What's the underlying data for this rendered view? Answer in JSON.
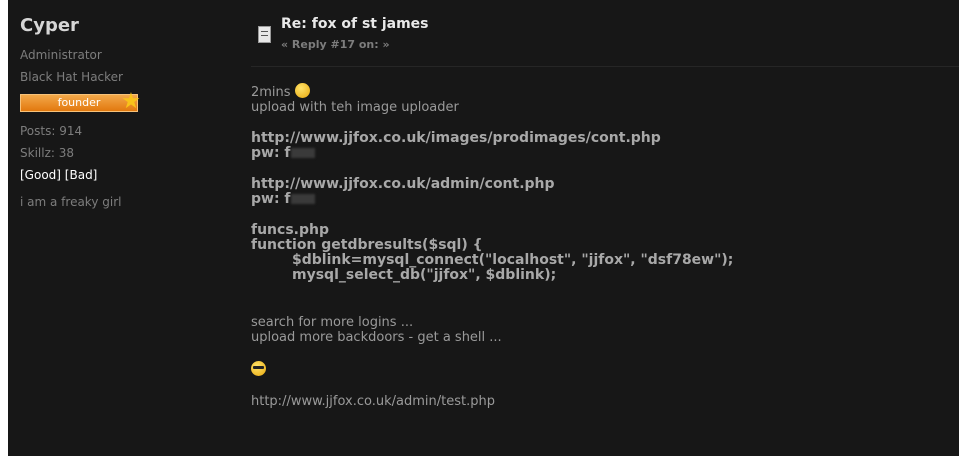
{
  "sidebar": {
    "username": "Cyper",
    "role": "Administrator",
    "title": "Black Hat Hacker",
    "badge_label": "founder",
    "posts": "Posts: 914",
    "skillz": "Skillz: 38",
    "karma_good": "[Good]",
    "karma_bad": "[Bad]",
    "personal_text": "i am a freaky girl"
  },
  "post": {
    "title": "Re: fox of st james",
    "reply_label": "« Reply #17 on: »",
    "lines": {
      "l1": "2mins",
      "l2": "upload with teh image uploader",
      "url1": "http://www.jjfox.co.uk/images/prodimages/cont.php",
      "pw1": "pw: f",
      "url2": "http://www.jjfox.co.uk/admin/cont.php",
      "pw2": "pw: f",
      "code1": "funcs.php",
      "code2": "function getdbresults($sql) {",
      "code3": "$dblink=mysql_connect(\"localhost\", \"jjfox\", \"dsf78ew\");",
      "code4": "mysql_select_db(\"jjfox\", $dblink);",
      "search": "search for more logins ...",
      "upload": "upload more backdoors - get a shell ...",
      "last_url": "http://www.jjfox.co.uk/admin/test.php"
    }
  },
  "icons": {
    "smiley": "grin-smiley-icon",
    "cool": "sunglasses-smiley-icon",
    "post": "document-icon",
    "badge": "star-icon"
  }
}
